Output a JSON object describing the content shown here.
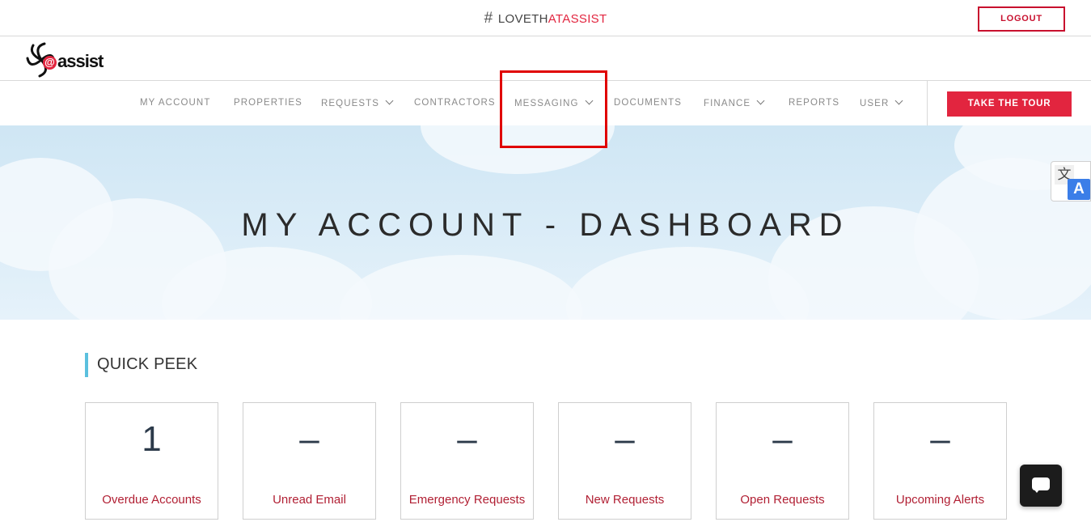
{
  "topbar": {
    "hash_symbol": "#",
    "hashtag_plain": "LOVETH",
    "hashtag_accent": "ATASSIST",
    "logout_label": "LOGOUT"
  },
  "logo": {
    "at_symbol": "@",
    "text": "assist"
  },
  "nav": {
    "items": [
      {
        "label": "MY ACCOUNT",
        "dropdown": false
      },
      {
        "label": "PROPERTIES",
        "dropdown": false
      },
      {
        "label": "REQUESTS",
        "dropdown": true
      },
      {
        "label": "CONTRACTORS",
        "dropdown": false
      },
      {
        "label": "MESSAGING",
        "dropdown": true
      },
      {
        "label": "DOCUMENTS",
        "dropdown": false
      },
      {
        "label": "FINANCE",
        "dropdown": true
      },
      {
        "label": "REPORTS",
        "dropdown": false
      },
      {
        "label": "USER",
        "dropdown": true
      }
    ],
    "tour_label": "TAKE THE TOUR"
  },
  "hero": {
    "title": "MY ACCOUNT - DASHBOARD"
  },
  "translate": {
    "source_glyph": "文",
    "target_glyph": "A"
  },
  "quick_peek": {
    "title": "QUICK PEEK",
    "cards": [
      {
        "value": "1",
        "label": "Overdue Accounts"
      },
      {
        "value": "–",
        "label": "Unread Email"
      },
      {
        "value": "–",
        "label": "Emergency Requests"
      },
      {
        "value": "–",
        "label": "New Requests"
      },
      {
        "value": "–",
        "label": "Open Requests"
      },
      {
        "value": "–",
        "label": "Upcoming Alerts"
      }
    ]
  },
  "colors": {
    "brand_red": "#e2253f",
    "accent_blue": "#5bc0de",
    "highlight": "#e00000"
  },
  "icons": {
    "chat": "chat-icon",
    "translate": "translate-icon",
    "chevron": "chevron-down-icon"
  }
}
